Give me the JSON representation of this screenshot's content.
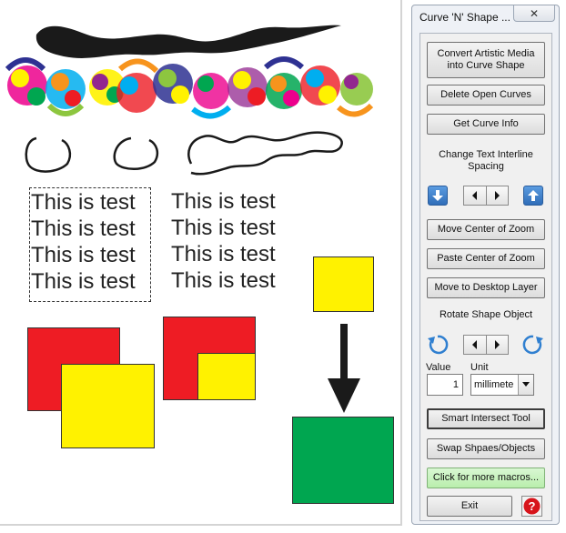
{
  "canvas": {
    "sample_texts": [
      "This is test",
      "This is test",
      "This is test",
      "This is test"
    ],
    "sample_texts_right": [
      "This is test",
      "This is test",
      "This is test",
      "This is test"
    ],
    "colors": {
      "red": "#ee1c24",
      "yellow": "#fff200",
      "green": "#00a650",
      "ink": "#1a1a1a"
    }
  },
  "docker": {
    "title": "Curve 'N' Shape ...",
    "close_icon": "close-icon",
    "convert_button": "Convert Artistic Media into Curve Shape",
    "delete_open_curves": "Delete Open Curves",
    "get_curve_info": "Get Curve Info",
    "change_text_label": "Change Text Interline Spacing",
    "move_center_zoom": "Move Center of Zoom",
    "paste_center_zoom": "Paste Center of Zoom",
    "move_desktop_layer": "Move to Desktop Layer",
    "rotate_label": "Rotate Shape Object",
    "value_label": "Value",
    "unit_label": "Unit",
    "value": "1",
    "unit": "millimete",
    "smart_intersect": "Smart Intersect Tool",
    "swap_shapes": "Swap Shpaes/Objects",
    "more_macros": "Click for more macros...",
    "exit": "Exit",
    "help_icon": "help-icon"
  }
}
